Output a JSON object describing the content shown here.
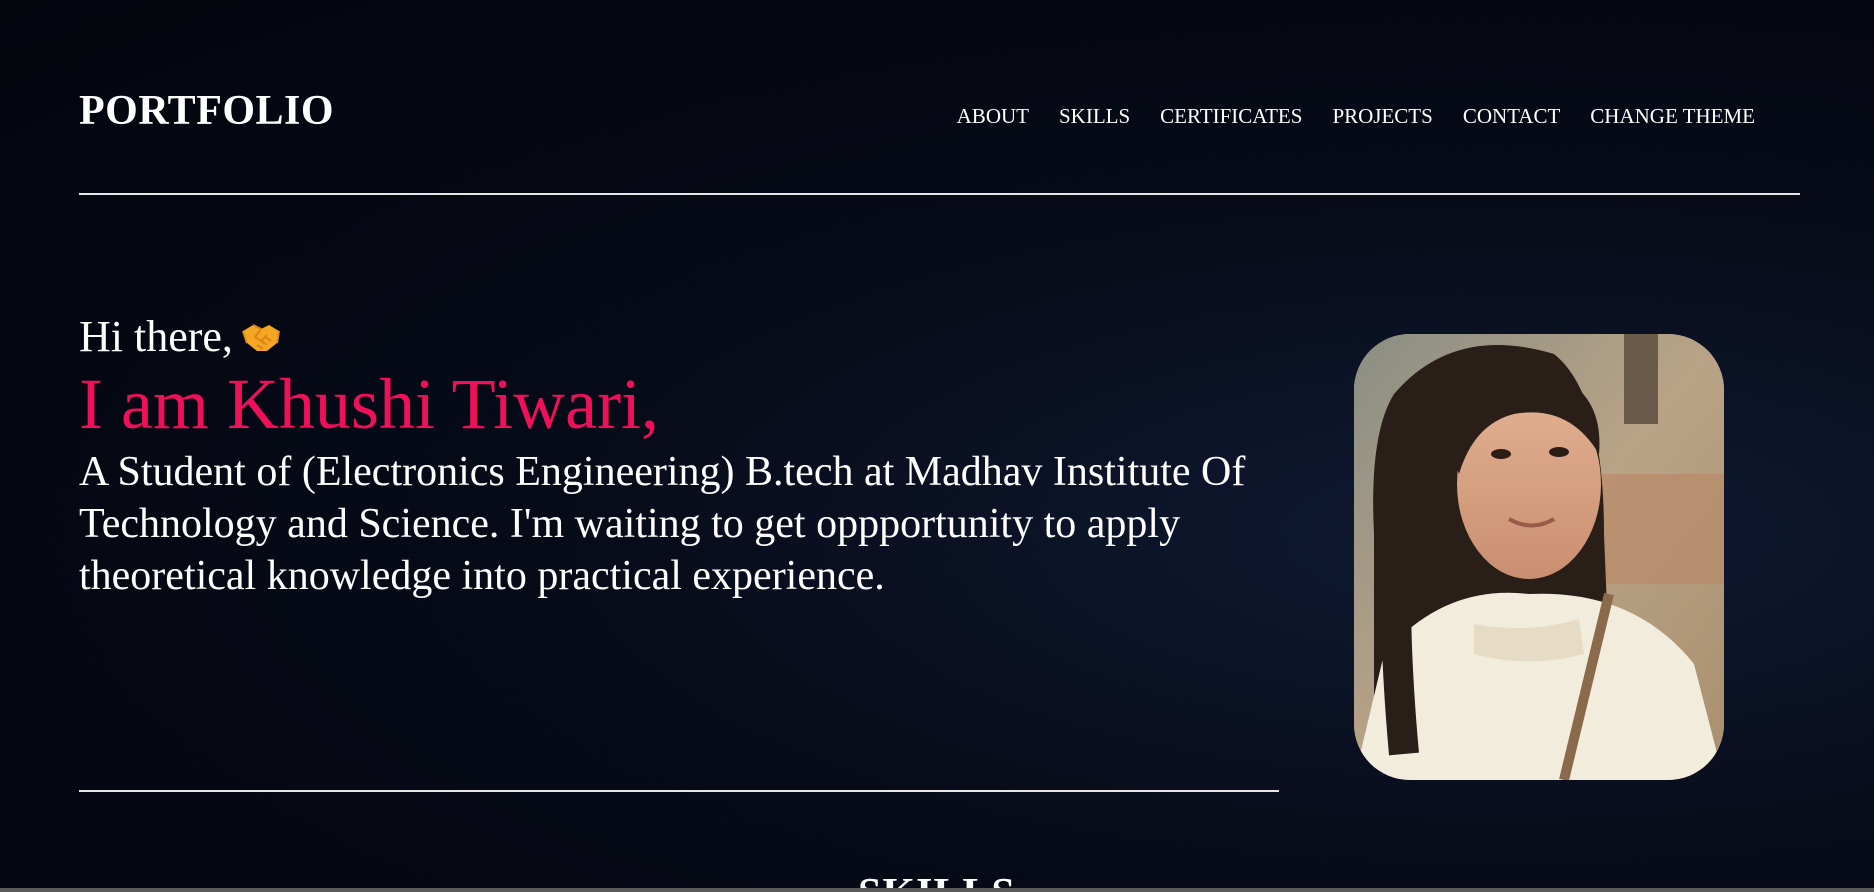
{
  "header": {
    "brand": "PORTFOLIO",
    "menu": [
      {
        "label": "ABOUT"
      },
      {
        "label": "SKILLS"
      },
      {
        "label": "CERTIFICATES"
      },
      {
        "label": "PROJECTS"
      },
      {
        "label": "CONTACT"
      },
      {
        "label": "CHANGE THEME"
      }
    ]
  },
  "hero": {
    "greeting": "Hi there,",
    "greeting_icon": "handshake-icon",
    "name": "I am Khushi Tiwari,",
    "bio": "A Student of (Electronics Engineering) B.tech at Madhav Institute Of Technology and Science. I'm waiting to get oppportunity to apply theoretical knowledge into practical experience.",
    "photo_icon": "profile-photo"
  },
  "sections": {
    "skills_heading": "SKILLS"
  },
  "colors": {
    "accent": "#f0105a",
    "background": "#070b18",
    "text": "#ffffff"
  }
}
